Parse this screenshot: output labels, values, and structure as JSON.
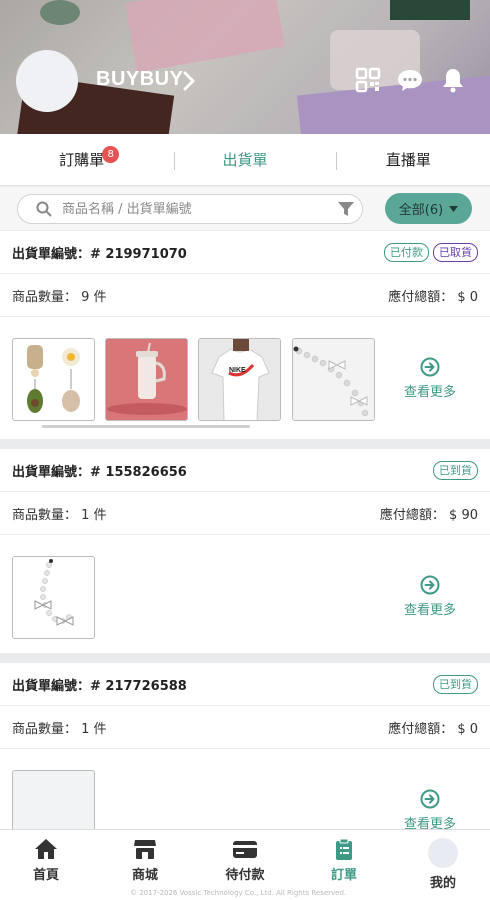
{
  "header": {
    "shop_name": "BUYBUY",
    "icons": [
      "qr-code-icon",
      "chat-icon",
      "bell-icon"
    ]
  },
  "tabs": [
    {
      "label": "訂購單",
      "badge": "8"
    },
    {
      "label": "出貨單",
      "active": true
    },
    {
      "label": "直播單"
    }
  ],
  "search": {
    "placeholder": "商品名稱 / 出貨單編號",
    "filter_label": "全部(6)"
  },
  "orders": [
    {
      "order_no": "出貨單編號：# 219971070",
      "tags": [
        "已付款",
        "已取貨"
      ],
      "qty": "商品數量： 9 件",
      "total": "應付總額： $ 0",
      "more": "查看更多"
    },
    {
      "order_no": "出貨單編號：# 155826656",
      "tags": [
        "已到貨"
      ],
      "qty": "商品數量： 1 件",
      "total": "應付總額： $ 90",
      "more": "查看更多"
    },
    {
      "order_no": "出貨單編號：# 217726588",
      "tags": [
        "已到貨"
      ],
      "qty": "商品數量： 1 件",
      "total": "應付總額： $ 0",
      "more": "查看更多"
    }
  ],
  "bottom_nav": [
    {
      "label": "首頁",
      "icon": "home-icon"
    },
    {
      "label": "商城",
      "icon": "store-icon"
    },
    {
      "label": "待付款",
      "icon": "card-icon"
    },
    {
      "label": "訂單",
      "icon": "clipboard-icon",
      "active": true
    },
    {
      "label": "我的",
      "icon": "avatar"
    }
  ],
  "footer": {
    "copyright": "© 2017-2026 Vossic Technology Co., Ltd. All Rights Reserved."
  },
  "colors": {
    "accent": "#3e9a86",
    "badge": "#e65353",
    "purple_tag": "#6b41a8"
  }
}
